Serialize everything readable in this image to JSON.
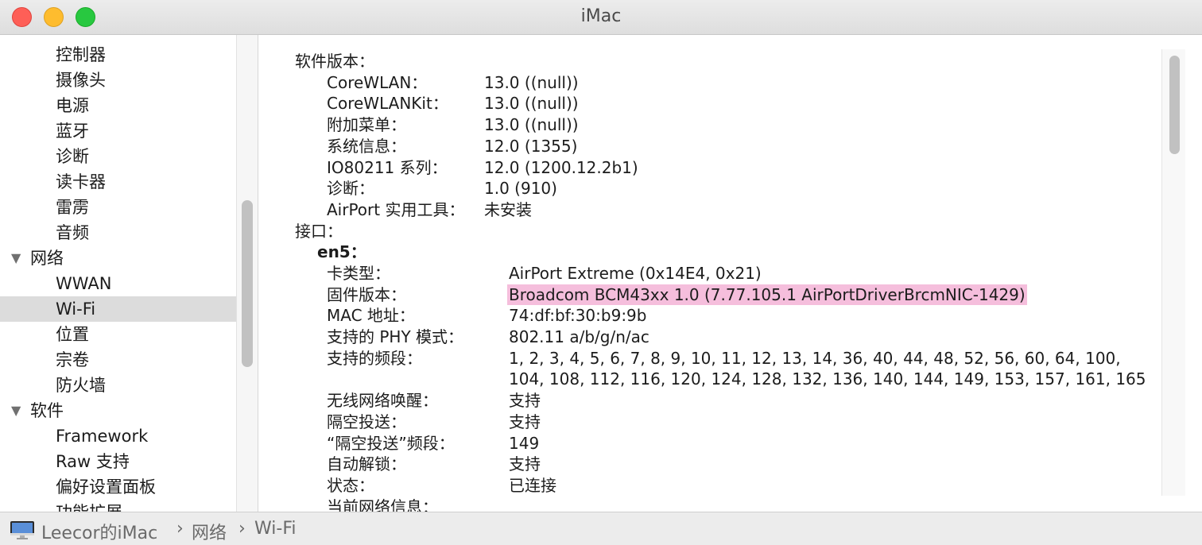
{
  "window": {
    "title": "iMac"
  },
  "sidebar": {
    "items": [
      {
        "label": "控制器",
        "type": "child"
      },
      {
        "label": "摄像头",
        "type": "child"
      },
      {
        "label": "电源",
        "type": "child"
      },
      {
        "label": "蓝牙",
        "type": "child"
      },
      {
        "label": "诊断",
        "type": "child"
      },
      {
        "label": "读卡器",
        "type": "child"
      },
      {
        "label": "雷雳",
        "type": "child"
      },
      {
        "label": "音频",
        "type": "child"
      },
      {
        "label": "网络",
        "type": "group"
      },
      {
        "label": "WWAN",
        "type": "child"
      },
      {
        "label": "Wi-Fi",
        "type": "child",
        "selected": true
      },
      {
        "label": "位置",
        "type": "child"
      },
      {
        "label": "宗卷",
        "type": "child"
      },
      {
        "label": "防火墙",
        "type": "child"
      },
      {
        "label": "软件",
        "type": "group"
      },
      {
        "label": "Framework",
        "type": "child"
      },
      {
        "label": "Raw 支持",
        "type": "child"
      },
      {
        "label": "偏好设置面板",
        "type": "child"
      },
      {
        "label": "功能扩展",
        "type": "child"
      }
    ],
    "disclosure_glyph": "▼"
  },
  "content": {
    "software_header": "软件版本：",
    "software": [
      {
        "k": "CoreWLAN：",
        "v": "13.0 ((null))"
      },
      {
        "k": "CoreWLANKit：",
        "v": "13.0 ((null))"
      },
      {
        "k": "附加菜单：",
        "v": "13.0 ((null))"
      },
      {
        "k": "系统信息：",
        "v": "12.0 (1355)"
      },
      {
        "k": "IO80211 系列：",
        "v": "12.0 (1200.12.2b1)"
      },
      {
        "k": "诊断：",
        "v": "1.0 (910)"
      },
      {
        "k": "AirPort 实用工具：",
        "v": "未安装"
      }
    ],
    "interfaces_header": "接口：",
    "interface_name": "en5：",
    "interface": [
      {
        "k": "卡类型：",
        "v": "AirPort Extreme  (0x14E4, 0x21)"
      },
      {
        "k": "固件版本：",
        "v": "Broadcom BCM43xx 1.0 (7.77.105.1 AirPortDriverBrcmNIC-1429)",
        "highlight": true
      },
      {
        "k": "MAC 地址：",
        "v": "74:df:bf:30:b9:9b"
      },
      {
        "k": "支持的 PHY 模式：",
        "v": "802.11 a/b/g/n/ac"
      },
      {
        "k": "支持的频段：",
        "v": "1, 2, 3, 4, 5, 6, 7, 8, 9, 10, 11, 12, 13, 14, 36, 40, 44, 48, 52, 56, 60, 64, 100,",
        "v2": "104, 108, 112, 116, 120, 124, 128, 132, 136, 140, 144, 149, 153, 157, 161, 165"
      },
      {
        "k": "无线网络唤醒：",
        "v": "支持"
      },
      {
        "k": "隔空投送：",
        "v": "支持"
      },
      {
        "k": "“隔空投送”频段：",
        "v": "149"
      },
      {
        "k": "自动解锁：",
        "v": "支持"
      },
      {
        "k": "状态：",
        "v": "已连接"
      },
      {
        "k": "当前网络信息：",
        "v": ""
      }
    ]
  },
  "statusbar": {
    "computer": "Leecor的iMac",
    "sep": "›",
    "crumb1": "网络",
    "crumb2": "Wi-Fi",
    "icon": "imac-icon"
  },
  "colors": {
    "highlight": "#f5bedc",
    "selected_row": "#dcdcdc",
    "close": "#fe5f57",
    "minimize": "#febc2e",
    "maximize": "#28c840"
  }
}
